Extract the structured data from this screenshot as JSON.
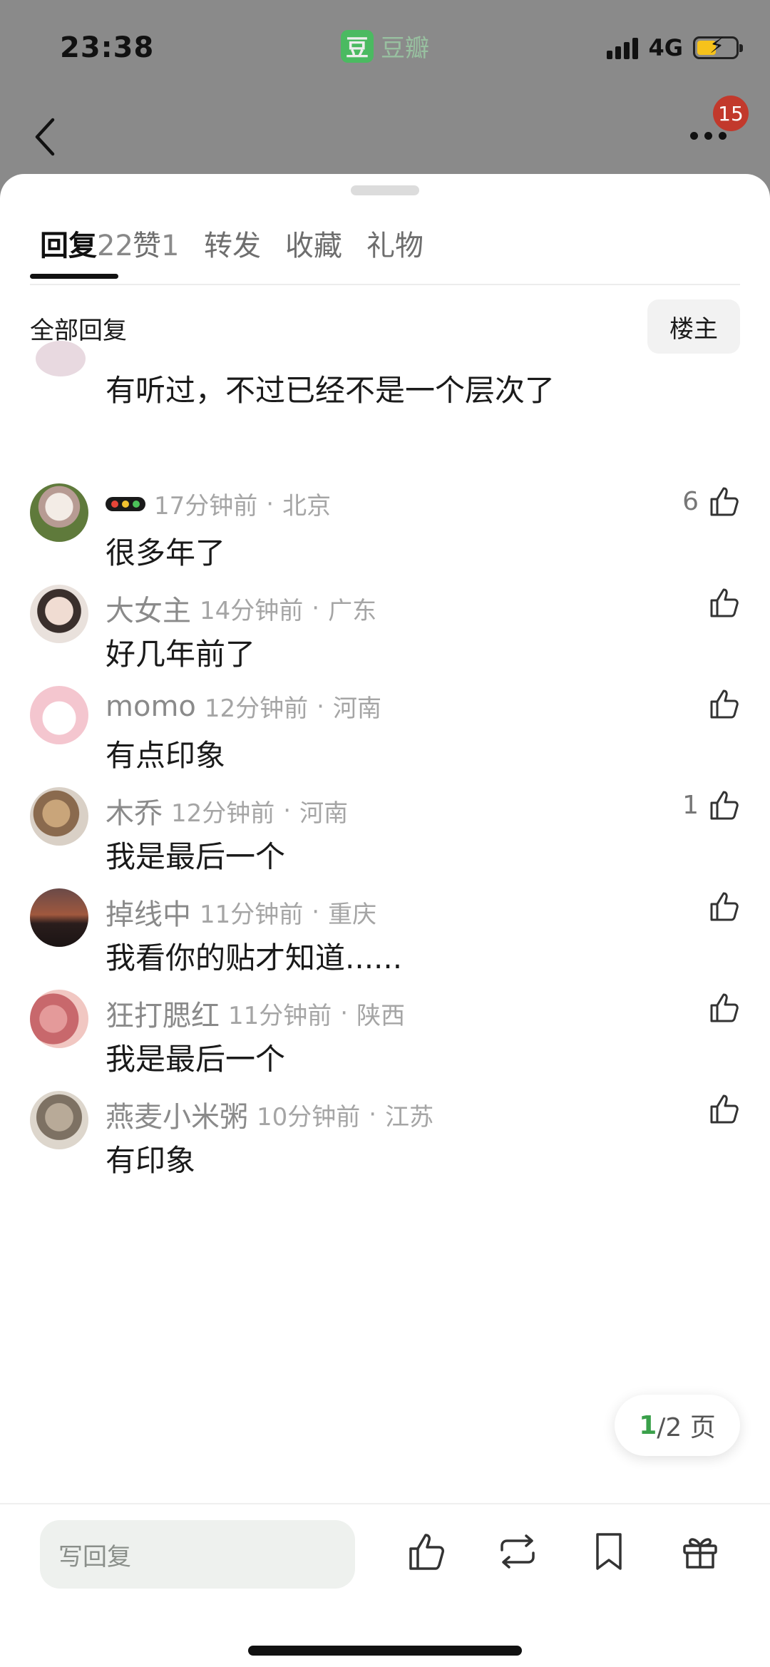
{
  "status_bar": {
    "time": "23:38",
    "app_badge": "豆瓣",
    "network": "4G"
  },
  "nav": {
    "notification_count": "15"
  },
  "tabs": [
    {
      "label": "回复",
      "count": "22"
    },
    {
      "label": "赞",
      "count": "1"
    },
    {
      "label": "转发",
      "count": ""
    },
    {
      "label": "收藏",
      "count": ""
    },
    {
      "label": "礼物",
      "count": ""
    }
  ],
  "filter": {
    "all_label": "全部回复",
    "owner_label": "楼主"
  },
  "partial_comment": {
    "text": "有听过，不过已经不是一个层次了"
  },
  "comments": [
    {
      "user": "",
      "time": "17分钟前",
      "location": "北京",
      "text": "很多年了",
      "likes": "6"
    },
    {
      "user": "大女主",
      "time": "14分钟前",
      "location": "广东",
      "text": "好几年前了",
      "likes": ""
    },
    {
      "user": "momo",
      "time": "12分钟前",
      "location": "河南",
      "text": "有点印象",
      "likes": ""
    },
    {
      "user": "木乔",
      "time": "12分钟前",
      "location": "河南",
      "text": "我是最后一个",
      "likes": "1"
    },
    {
      "user": "掉线中",
      "time": "11分钟前",
      "location": "重庆",
      "text": "我看你的贴才知道......",
      "likes": ""
    },
    {
      "user": "狂打腮红",
      "time": "11分钟前",
      "location": "陕西",
      "text": "我是最后一个",
      "likes": ""
    },
    {
      "user": "燕麦小米粥",
      "time": "10分钟前",
      "location": "江苏",
      "text": "有印象",
      "likes": ""
    }
  ],
  "separator": "·",
  "pagination": {
    "current": "1",
    "rest": "/2 页"
  },
  "bottom": {
    "reply_placeholder": "写回复"
  },
  "colors": {
    "accent_green": "#41c35a",
    "badge_red": "#c2392c"
  }
}
